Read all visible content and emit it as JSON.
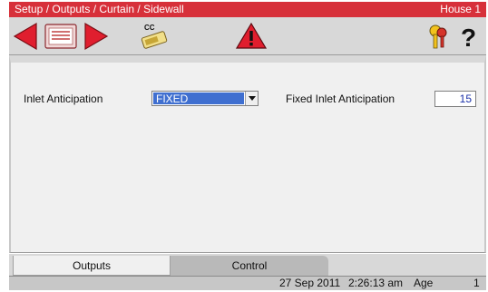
{
  "window": {
    "title": "Setup / Outputs / Curtain / Sidewall",
    "house": "House 1"
  },
  "toolbar": {
    "buttons": [
      {
        "name": "back-arrow-icon"
      },
      {
        "name": "menu-icon"
      },
      {
        "name": "forward-arrow-icon"
      },
      {
        "name": "copy-settings-icon",
        "label": "CC"
      },
      {
        "name": "alarm-warning-icon",
        "label": "!"
      },
      {
        "name": "keys-icon"
      },
      {
        "name": "help-icon",
        "label": "?"
      }
    ]
  },
  "form": {
    "inlet_anticipation_label": "Inlet Anticipation",
    "inlet_anticipation_value": "FIXED",
    "fixed_inlet_anticipation_label": "Fixed Inlet Anticipation",
    "fixed_inlet_anticipation_value": "15"
  },
  "tabs": [
    {
      "label": "Outputs",
      "active": true
    },
    {
      "label": "Control",
      "active": false
    }
  ],
  "status": {
    "date": "27 Sep 2011",
    "time": "2:26:13 am",
    "age_label": "Age",
    "age_value": "1"
  },
  "colors": {
    "title_bar": "#d7303a",
    "selection": "#3f6fd0",
    "numeric_text": "#1a30a8"
  }
}
